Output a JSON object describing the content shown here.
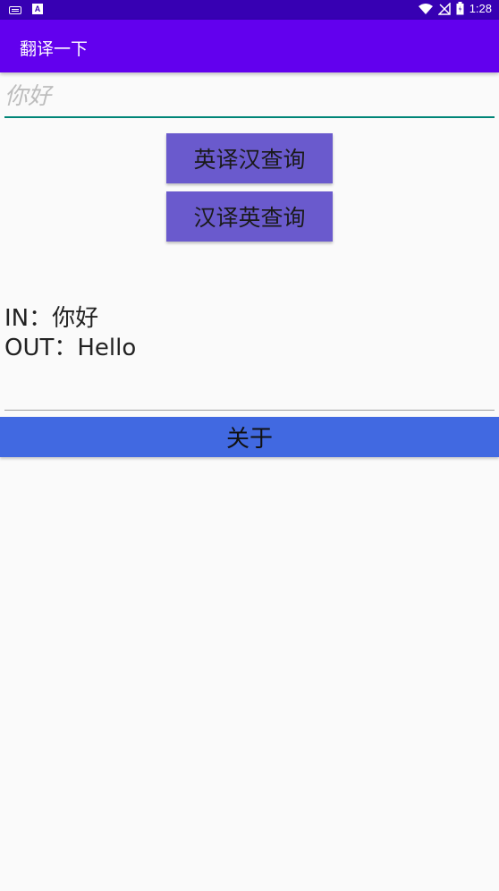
{
  "status_bar": {
    "time": "1:28",
    "left_icons": [
      "keyboard-icon",
      "a-app-icon"
    ],
    "right_icons": [
      "wifi-icon",
      "no-signal-icon",
      "battery-icon"
    ]
  },
  "app_bar": {
    "title": "翻译一下",
    "color": "#6200ee"
  },
  "input": {
    "placeholder": "你好",
    "value": ""
  },
  "buttons": {
    "en_to_zh": "英译汉查询",
    "zh_to_en": "汉译英查询",
    "about": "关于"
  },
  "result": {
    "in_line": "IN：你好",
    "out_line": "OUT：Hello"
  },
  "colors": {
    "status_bar": "#3700b3",
    "accent_line": "#008577",
    "query_button": "#6a5acd",
    "about_button": "#4169e1"
  }
}
